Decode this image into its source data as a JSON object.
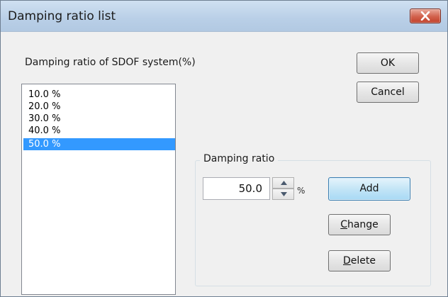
{
  "window": {
    "title": "Damping ratio list"
  },
  "list_label": "Damping ratio of SDOF system(%)",
  "damping_list": {
    "items": [
      "10.0 %",
      "20.0 %",
      "30.0 %",
      "40.0 %",
      "50.0 %"
    ],
    "selected_index": 4
  },
  "buttons": {
    "ok": "OK",
    "cancel": "Cancel",
    "add": "Add",
    "change_underlined": "C",
    "change_rest": "hange",
    "delete_underlined": "D",
    "delete_rest": "elete"
  },
  "group": {
    "title": "Damping ratio",
    "value": "50.0",
    "unit": "%"
  },
  "icons": {
    "close": "close-icon",
    "spin_up": "chevron-up-icon",
    "spin_down": "chevron-down-icon"
  },
  "colors": {
    "selection": "#3399ff",
    "titlebar": "#b9cfe7",
    "close_button": "#c2412b"
  }
}
